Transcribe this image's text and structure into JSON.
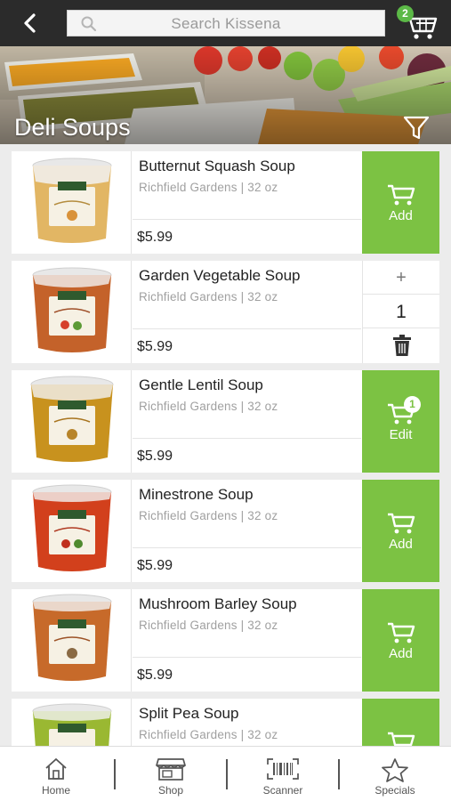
{
  "header": {
    "search_placeholder": "Search Kissena",
    "cart_count": "2"
  },
  "banner": {
    "title": "Deli Soups"
  },
  "products": [
    {
      "name": "Butternut Squash Soup",
      "meta": "Richfield Gardens | 32 oz",
      "price": "$5.99",
      "action": "Add",
      "soup_color": "#e2b664"
    },
    {
      "name": "Garden Vegetable Soup",
      "meta": "Richfield Gardens | 32 oz",
      "price": "$5.99",
      "quantity": "1",
      "soup_color": "#c4622a"
    },
    {
      "name": "Gentle Lentil Soup",
      "meta": "Richfield Gardens | 32 oz",
      "price": "$5.99",
      "action": "Edit",
      "edit_count": "1",
      "soup_color": "#c8921e"
    },
    {
      "name": "Minestrone Soup",
      "meta": "Richfield Gardens | 32 oz",
      "price": "$5.99",
      "action": "Add",
      "soup_color": "#d2401c"
    },
    {
      "name": "Mushroom Barley Soup",
      "meta": "Richfield Gardens | 32 oz",
      "price": "$5.99",
      "action": "Add",
      "soup_color": "#c76a2a"
    },
    {
      "name": "Split Pea Soup",
      "meta": "Richfield Gardens | 32 oz",
      "price": "",
      "action": "",
      "soup_color": "#9ab832"
    }
  ],
  "nav": {
    "home": "Home",
    "shop": "Shop",
    "scanner": "Scanner",
    "specials": "Specials"
  },
  "colors": {
    "topbar": "#2b2b2b",
    "action_green": "#7cc243",
    "badge_green": "#5cb947"
  }
}
